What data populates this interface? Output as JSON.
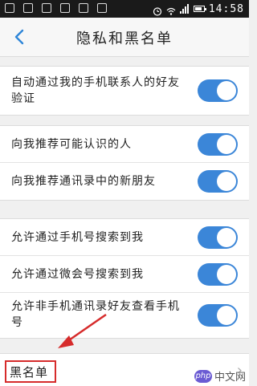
{
  "status_bar": {
    "time": "14:58"
  },
  "header": {
    "title": "隐私和黑名单",
    "back_icon": "chevron-left-icon"
  },
  "sections": [
    {
      "items": [
        {
          "label": "自动通过我的手机联系人的好友验证",
          "enabled": true
        }
      ]
    },
    {
      "items": [
        {
          "label": "向我推荐可能认识的人",
          "enabled": true
        },
        {
          "label": "向我推荐通讯录中的新朋友",
          "enabled": true
        }
      ]
    },
    {
      "items": [
        {
          "label": "允许通过手机号搜索到我",
          "enabled": true
        },
        {
          "label": "允许通过微会号搜索到我",
          "enabled": true
        },
        {
          "label": "允许非手机通讯录好友查看手机号",
          "enabled": true
        }
      ]
    }
  ],
  "blacklist": {
    "label": "黑名单"
  },
  "watermark": {
    "logo": "php",
    "text": "中文网"
  },
  "colors": {
    "accent": "#3b86d8",
    "highlight": "#d62b2b"
  }
}
